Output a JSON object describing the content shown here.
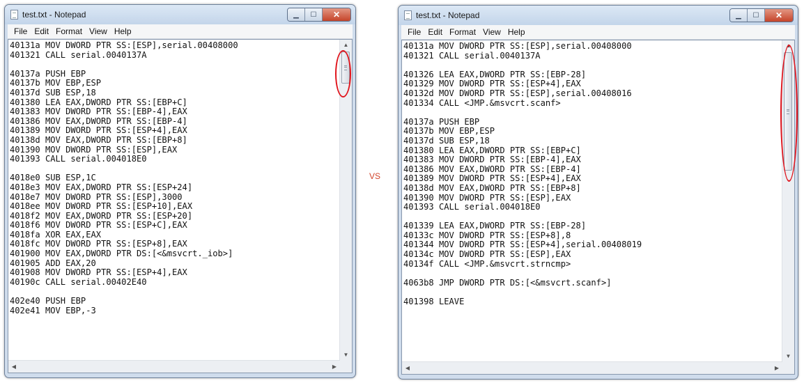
{
  "vs_label": "VS",
  "left": {
    "title": "test.txt - Notepad",
    "menu": [
      "File",
      "Edit",
      "Format",
      "View",
      "Help"
    ],
    "content": "40131a MOV DWORD PTR SS:[ESP],serial.00408000\n401321 CALL serial.0040137A\n\n40137a PUSH EBP\n40137b MOV EBP,ESP\n40137d SUB ESP,18\n401380 LEA EAX,DWORD PTR SS:[EBP+C]\n401383 MOV DWORD PTR SS:[EBP-4],EAX\n401386 MOV EAX,DWORD PTR SS:[EBP-4]\n401389 MOV DWORD PTR SS:[ESP+4],EAX\n40138d MOV EAX,DWORD PTR SS:[EBP+8]\n401390 MOV DWORD PTR SS:[ESP],EAX\n401393 CALL serial.004018E0\n\n4018e0 SUB ESP,1C\n4018e3 MOV EAX,DWORD PTR SS:[ESP+24]\n4018e7 MOV DWORD PTR SS:[ESP],3000\n4018ee MOV DWORD PTR SS:[ESP+10],EAX\n4018f2 MOV EAX,DWORD PTR SS:[ESP+20]\n4018f6 MOV DWORD PTR SS:[ESP+C],EAX\n4018fa XOR EAX,EAX\n4018fc MOV DWORD PTR SS:[ESP+8],EAX\n401900 MOV EAX,DWORD PTR DS:[<&msvcrt._iob>]\n401905 ADD EAX,20\n401908 MOV DWORD PTR SS:[ESP+4],EAX\n40190c CALL serial.00402E40\n\n402e40 PUSH EBP\n402e41 MOV EBP,-3"
  },
  "right": {
    "title": "test.txt - Notepad",
    "menu": [
      "File",
      "Edit",
      "Format",
      "View",
      "Help"
    ],
    "content": "40131a MOV DWORD PTR SS:[ESP],serial.00408000\n401321 CALL serial.0040137A\n\n401326 LEA EAX,DWORD PTR SS:[EBP-28]\n401329 MOV DWORD PTR SS:[ESP+4],EAX\n40132d MOV DWORD PTR SS:[ESP],serial.00408016\n401334 CALL <JMP.&msvcrt.scanf>\n\n40137a PUSH EBP\n40137b MOV EBP,ESP\n40137d SUB ESP,18\n401380 LEA EAX,DWORD PTR SS:[EBP+C]\n401383 MOV DWORD PTR SS:[EBP-4],EAX\n401386 MOV EAX,DWORD PTR SS:[EBP-4]\n401389 MOV DWORD PTR SS:[ESP+4],EAX\n40138d MOV EAX,DWORD PTR SS:[EBP+8]\n401390 MOV DWORD PTR SS:[ESP],EAX\n401393 CALL serial.004018E0\n\n401339 LEA EAX,DWORD PTR SS:[EBP-28]\n40133c MOV DWORD PTR SS:[ESP+8],8\n401344 MOV DWORD PTR SS:[ESP+4],serial.00408019\n40134c MOV DWORD PTR SS:[ESP],EAX\n40134f CALL <JMP.&msvcrt.strncmp>\n\n4063b8 JMP DWORD PTR DS:[<&msvcrt.scanf>]\n\n401398 LEAVE"
  },
  "colors": {
    "highlight": "#e0141c",
    "vs": "#d2452c"
  }
}
